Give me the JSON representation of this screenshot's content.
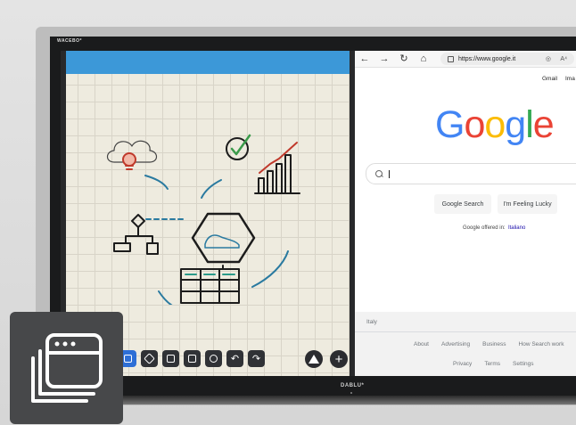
{
  "display": {
    "brand_top": "WACEBO*",
    "brand_bottom": "DABLU*"
  },
  "browser": {
    "url": "https://www.google.it",
    "top_links": [
      "Gmail",
      "Ima"
    ],
    "logo_letters": [
      {
        "ch": "G",
        "color": "#4285F4"
      },
      {
        "ch": "o",
        "color": "#EA4335"
      },
      {
        "ch": "o",
        "color": "#FBBC05"
      },
      {
        "ch": "g",
        "color": "#4285F4"
      },
      {
        "ch": "l",
        "color": "#34A853"
      },
      {
        "ch": "e",
        "color": "#EA4335"
      }
    ],
    "search_button": "Google Search",
    "lucky_button": "I'm Feeling Lucky",
    "offered_text": "Google offered in:",
    "offered_lang": "Italiano",
    "footer": {
      "country": "Italy",
      "row1": [
        "About",
        "Advertising",
        "Business",
        "How Search work"
      ],
      "row2": [
        "Privacy",
        "Terms",
        "Settings"
      ]
    }
  },
  "whiteboard": {
    "accent_color": "#3c98d8",
    "tools": [
      "select-tool-icon",
      "eraser-icon",
      "crop-icon",
      "capture-icon",
      "lasso-icon",
      "undo-icon",
      "redo-icon"
    ],
    "right_tools": [
      "shapes-icon",
      "add-icon"
    ]
  }
}
